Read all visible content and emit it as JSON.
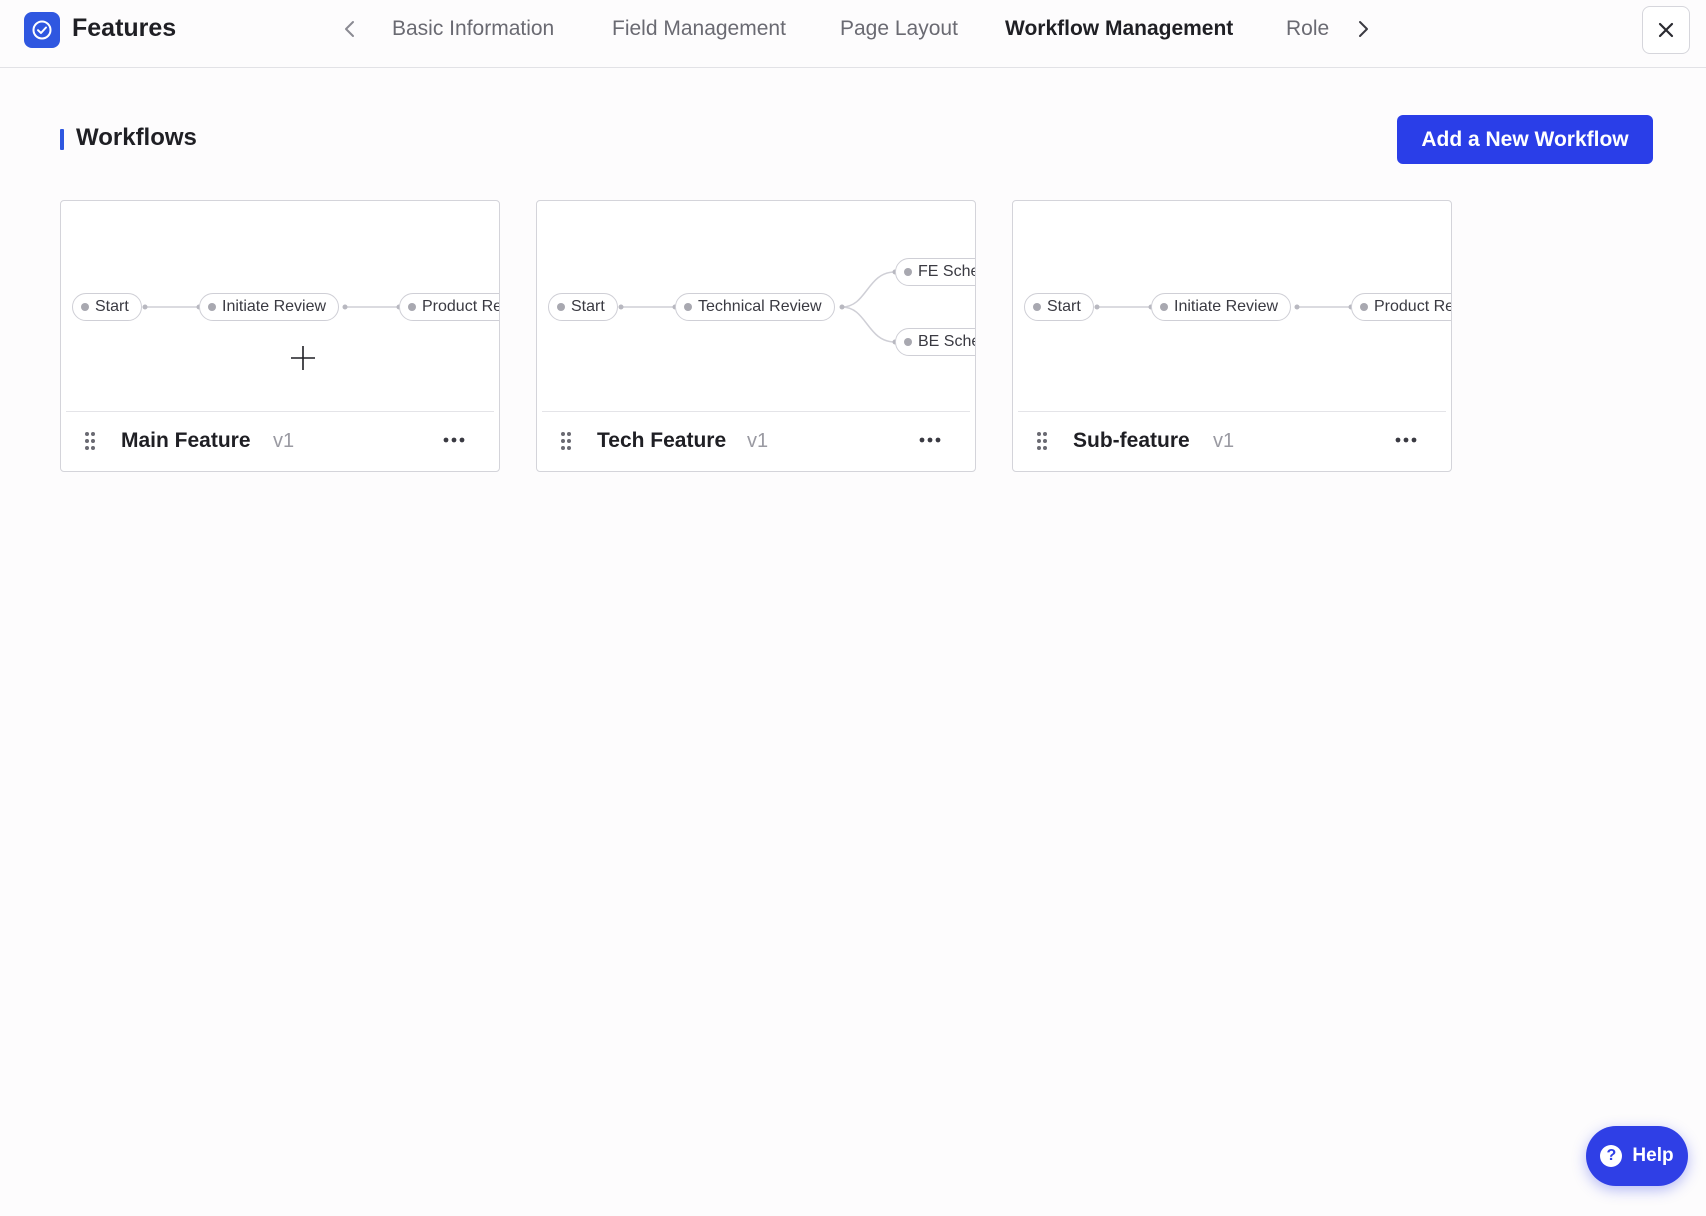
{
  "header": {
    "title": "Features",
    "tabs": [
      {
        "label": "Basic Information",
        "active": false
      },
      {
        "label": "Field Management",
        "active": false
      },
      {
        "label": "Page Layout",
        "active": false
      },
      {
        "label": "Workflow Management",
        "active": true
      },
      {
        "label": "Role",
        "active": false
      }
    ],
    "close_icon": "close-icon"
  },
  "section": {
    "title": "Workflows",
    "add_button_label": "Add a New Workflow"
  },
  "cards": [
    {
      "name": "Main Feature",
      "version": "v1",
      "nodes": [
        "Start",
        "Initiate Review",
        "Product Re"
      ]
    },
    {
      "name": "Tech Feature",
      "version": "v1",
      "nodes": [
        "Start",
        "Technical Review",
        "FE Sche",
        "BE Sche"
      ]
    },
    {
      "name": "Sub-feature",
      "version": "v1",
      "nodes": [
        "Start",
        "Initiate Review",
        "Product Re"
      ]
    }
  ],
  "help": {
    "label": "Help",
    "icon": "?"
  },
  "colors": {
    "accent": "#2a3ee8",
    "brand": "#2f57e0"
  }
}
